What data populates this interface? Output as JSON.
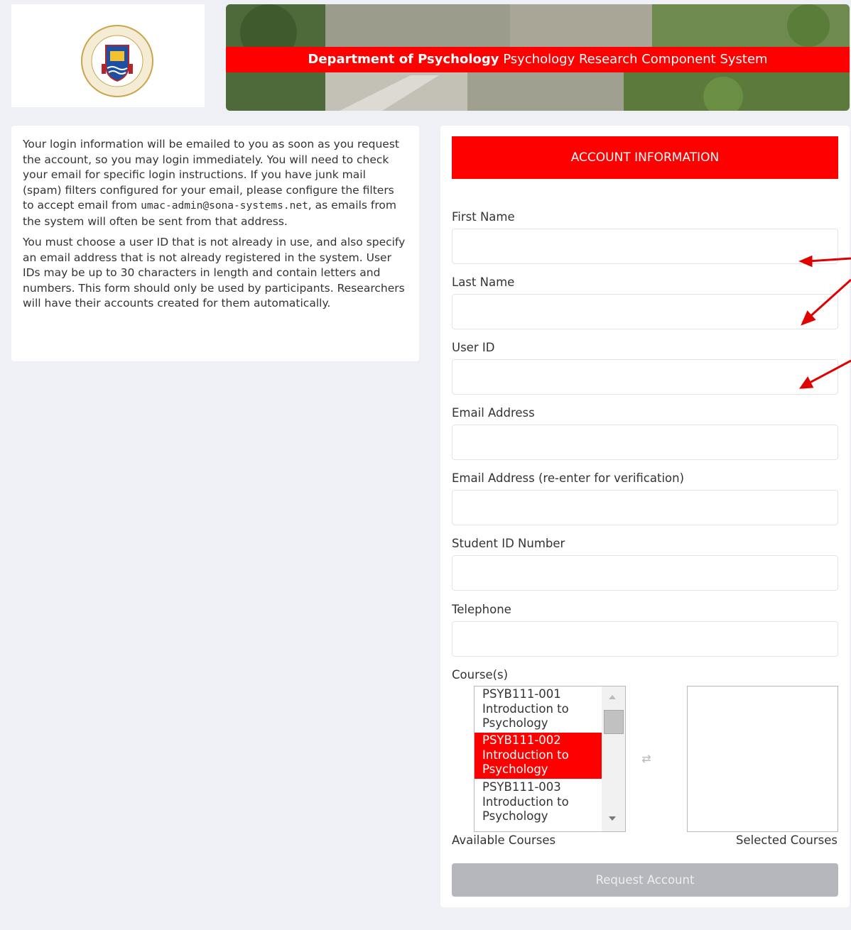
{
  "header": {
    "dept_bold": "Department of Psychology",
    "system_name": "Psychology Research Component System",
    "logo_lettering": [
      "UNIVERSIDADE DE MACAU",
      "澳門大學",
      "仁義禮知信"
    ]
  },
  "info": {
    "para1_a": "Your login information will be emailed to you as soon as you request the account, so you may login immediately. You will need to check your email for specific login instructions. If you have junk mail (spam) filters configured for your email, please configure the filters to accept email from ",
    "para1_email": "umac-admin@sona-systems.net",
    "para1_b": ", as emails from the system will often be sent from that address.",
    "para2": "You must choose a user ID that is not already in use, and also specify an email address that is not already registered in the system. User IDs may be up to 30 characters in length and contain letters and numbers. This form should only be used by participants. Researchers will have their accounts created for them automatically."
  },
  "form": {
    "title": "ACCOUNT INFORMATION",
    "fields": {
      "first_name": {
        "label": "First Name",
        "value": ""
      },
      "last_name": {
        "label": "Last Name",
        "value": ""
      },
      "user_id": {
        "label": "User ID",
        "value": ""
      },
      "email": {
        "label": "Email Address",
        "value": ""
      },
      "email_verify": {
        "label": "Email Address (re-enter for verification)",
        "value": ""
      },
      "student_id": {
        "label": "Student ID Number",
        "value": ""
      },
      "telephone": {
        "label": "Telephone",
        "value": ""
      }
    },
    "courses_label": "Course(s)",
    "available_courses": [
      {
        "line1": "PSYB111-001",
        "line2": "Introduction to",
        "line3": "Psychology",
        "selected": false
      },
      {
        "line1": "PSYB111-002",
        "line2": "Introduction to",
        "line3": "Psychology",
        "selected": true
      },
      {
        "line1": "PSYB111-003",
        "line2": "Introduction to",
        "line3": "Psychology",
        "selected": false
      }
    ],
    "available_caption": "Available Courses",
    "selected_caption": "Selected Courses",
    "submit_label": "Request Account"
  },
  "colors": {
    "accent": "#ff0000",
    "page_bg": "#eef0f5",
    "button_disabled": "#b5b7bc"
  },
  "icons": [
    "university-seal-logo",
    "swap-arrows-icon",
    "scroll-up-icon",
    "scroll-down-icon",
    "annotation-arrow"
  ]
}
